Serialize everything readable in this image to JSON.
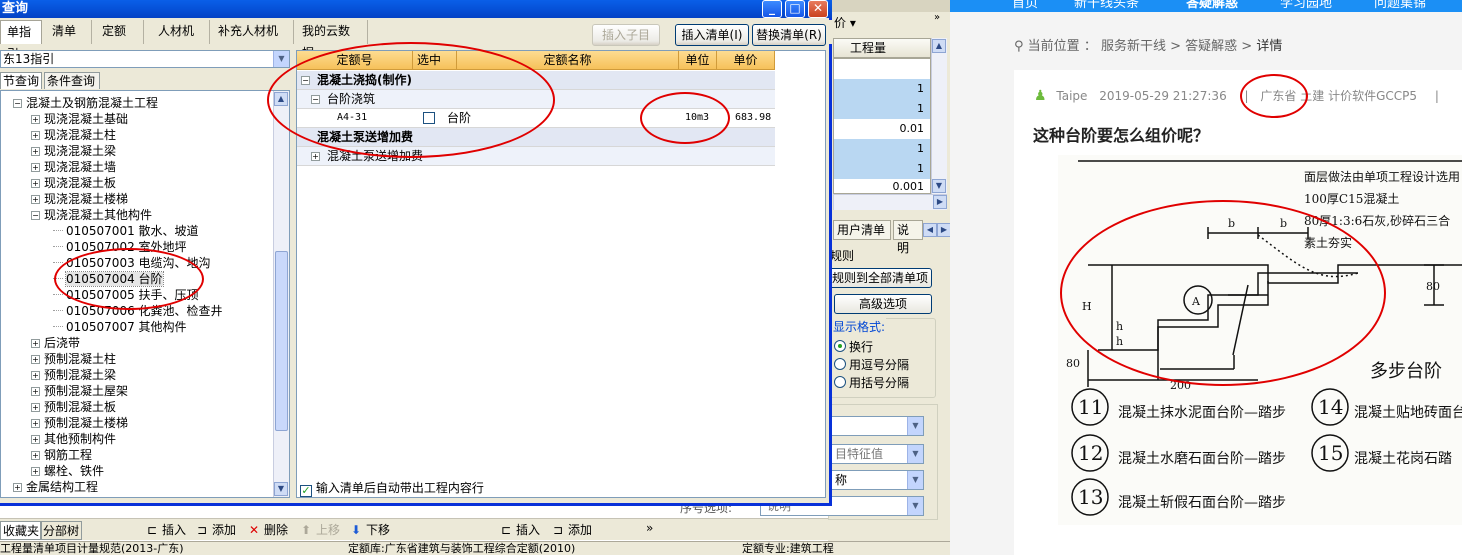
{
  "dialog": {
    "title": "查询",
    "tabs": [
      "单指引",
      "清单",
      "定额",
      "人材机",
      "补充人材机",
      "我的云数据"
    ],
    "buttons": {
      "insert_child": "插入子目",
      "insert_list": "插入清单(I)",
      "replace_list": "替换清单(R)"
    },
    "library_select": "东13指引",
    "subtabs": {
      "section": "节查询",
      "condition": "条件查询"
    },
    "tree": [
      {
        "label": "混凝土及钢筋混凝土工程",
        "level": 0,
        "expanded": true
      },
      {
        "label": "现浇混凝土基础",
        "level": 1
      },
      {
        "label": "现浇混凝土柱",
        "level": 1
      },
      {
        "label": "现浇混凝土梁",
        "level": 1
      },
      {
        "label": "现浇混凝土墙",
        "level": 1
      },
      {
        "label": "现浇混凝土板",
        "level": 1
      },
      {
        "label": "现浇混凝土楼梯",
        "level": 1
      },
      {
        "label": "现浇混凝土其他构件",
        "level": 1,
        "expanded": true
      },
      {
        "label": "010507001  散水、坡道",
        "level": 2
      },
      {
        "label": "010507002  室外地坪",
        "level": 2
      },
      {
        "label": "010507003  电缆沟、地沟",
        "level": 2
      },
      {
        "label": "010507004  台阶",
        "level": 2,
        "selected": true
      },
      {
        "label": "010507005  扶手、压顶",
        "level": 2
      },
      {
        "label": "010507006  化粪池、检查井",
        "level": 2
      },
      {
        "label": "010507007  其他构件",
        "level": 2
      },
      {
        "label": "后浇带",
        "level": 1
      },
      {
        "label": "预制混凝土柱",
        "level": 1
      },
      {
        "label": "预制混凝土梁",
        "level": 1
      },
      {
        "label": "预制混凝土屋架",
        "level": 1
      },
      {
        "label": "预制混凝土板",
        "level": 1
      },
      {
        "label": "预制混凝土楼梯",
        "level": 1
      },
      {
        "label": "其他预制构件",
        "level": 1
      },
      {
        "label": "钢筋工程",
        "level": 1
      },
      {
        "label": "螺栓、铁件",
        "level": 1
      },
      {
        "label": "金属结构工程",
        "level": 0
      }
    ],
    "grid": {
      "headers": [
        "定额号",
        "选中",
        "定额名称",
        "单位",
        "单价"
      ],
      "group1": "混凝土浇捣(制作)",
      "sub1": "台阶浇筑",
      "row": {
        "code": "A4-31",
        "name": "台阶",
        "unit": "10m3",
        "price": "683.98"
      },
      "group2": "混凝土泵送增加费",
      "sub2": "混凝土泵送增加费"
    },
    "auto_insert_label": "输入清单后自动带出工程内容行"
  },
  "bg_app": {
    "price_col": "价",
    "col_header": "工程量",
    "values": [
      "1",
      "1",
      "0.01",
      "1",
      "1",
      "0.001"
    ],
    "tabs": [
      "用户清单",
      "说明"
    ],
    "rules_label": "规则",
    "apply_all_btn": "规则到全部清单项",
    "advanced_btn": "高级选项",
    "format_label": "显示格式:",
    "radio_options": [
      "换行",
      "用逗号分隔",
      "用括号分隔"
    ],
    "combo_feature": "目特征值",
    "combo_name": "称",
    "order_label": "序号选项:",
    "order_value": "说明"
  },
  "bottom": {
    "tabs": [
      "收藏夹",
      "分部树"
    ],
    "buttons": [
      "插入",
      "添加",
      "删除",
      "上移",
      "下移",
      "插入",
      "添加"
    ]
  },
  "status": {
    "rules": "工程量清单项目计量规范(2013-广东)",
    "quota_lib": "定额库:广东省建筑与装饰工程综合定额(2010)",
    "specialty": "定额专业:建筑工程"
  },
  "web": {
    "nav_items": [
      "首页",
      "新干线头条",
      "答疑解惑",
      "学习园地",
      "问题集锦"
    ],
    "breadcrumb": [
      "当前位置",
      "服务新干线",
      "答疑解惑",
      "详情"
    ],
    "author": "Taipe",
    "datetime": "2019-05-29 21:27:36",
    "region": "广东省",
    "tags": "土建 计价软件GCCP5",
    "question": "这种台阶要怎么组价呢？",
    "drawing": {
      "notes": [
        "面层做法由单项工程设计选用",
        "100厚C15混凝土",
        "80厚1:3:6石灰,砂碎石三合",
        "素土夯实"
      ],
      "title": "多步台阶",
      "dims": [
        "b",
        "b",
        "H",
        "h",
        "h",
        "80",
        "200",
        "A"
      ],
      "items": [
        {
          "num": "11",
          "text": "混凝土抹水泥面台阶—踏步"
        },
        {
          "num": "12",
          "text": "混凝土水磨石面台阶—踏步"
        },
        {
          "num": "13",
          "text": "混凝土斩假石面台阶—踏步"
        },
        {
          "num": "14",
          "text": "混凝土贴地砖面台"
        },
        {
          "num": "15",
          "text": "混凝土花岗石踏"
        }
      ]
    }
  },
  "colors": {
    "highlight": "#e00000",
    "title_bar": "#0651d8",
    "grid_header": "#f6c15a",
    "web_nav": "#1b8ff5"
  }
}
